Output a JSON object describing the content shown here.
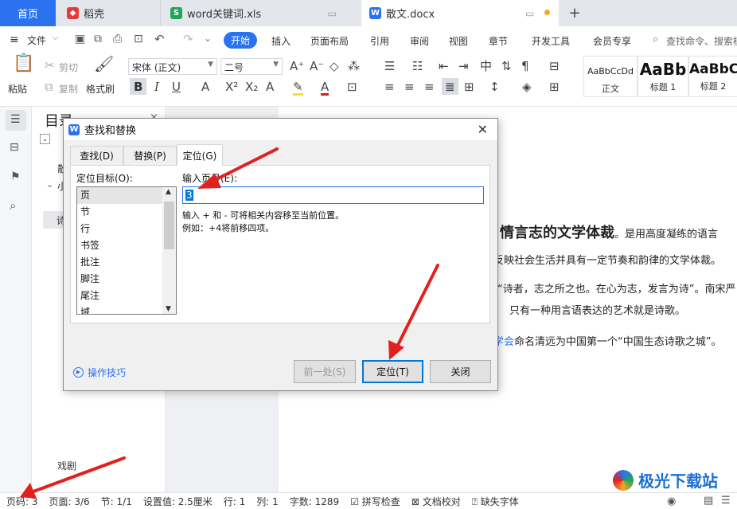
{
  "tabs": {
    "home": "首页",
    "daoke": "稻壳",
    "xls": "word关键词.xls",
    "docx": "散文.docx",
    "add": "+"
  },
  "menu": {
    "file": "文件",
    "items": [
      "开始",
      "插入",
      "页面布局",
      "引用",
      "审阅",
      "视图",
      "章节",
      "开发工具",
      "会员专享"
    ],
    "search": "查找命令、搜索模"
  },
  "ribbon": {
    "paste": "粘贴",
    "cut": "剪切",
    "copy": "复制",
    "format_painter": "格式刷",
    "font_name": "宋体 (正文)",
    "font_size": "二号",
    "styles": [
      {
        "sample": "AaBbCcDd",
        "name": "正文"
      },
      {
        "sample": "AaBb",
        "name": "标题 1"
      },
      {
        "sample": "AaBbC",
        "name": "标题 2"
      }
    ]
  },
  "nav": {
    "title": "目录",
    "item1": "散",
    "item2": "小",
    "item3": "诗",
    "bottom_item": "戏剧"
  },
  "document": {
    "line1_bold": "情言志的文学体裁",
    "line1_rest": "。是用高度凝练的语言",
    "line2": "反映社会生活并具有一定节奏和韵律的文学体裁。",
    "line3": "“诗者，志之所之也。在心为志，发言为诗”。南宋严",
    "line4": "只有一种用言语表达的艺术就是诗歌。",
    "line5_link": "学会",
    "line5_rest": "命名清远为中国第一个“中国生态诗歌之城”。"
  },
  "dialog": {
    "title": "查找和替换",
    "tab_find": "查找(D)",
    "tab_replace": "替换(P)",
    "tab_goto": "定位(G)",
    "target_label": "定位目标(O):",
    "targets": [
      "页",
      "节",
      "行",
      "书签",
      "批注",
      "脚注",
      "尾注",
      "域"
    ],
    "input_label": "输入页号(E):",
    "input_value": "3",
    "hint1": "输入 + 和 - 可将相关内容移至当前位置。",
    "hint2": "例如：+4将前移四项。",
    "tips": "操作技巧",
    "prev_button": "前一处(S)",
    "goto_button": "定位(T)",
    "close_button": "关闭"
  },
  "status": {
    "page_code": "页码: 3",
    "pages": "页面: 3/6",
    "section": "节: 1/1",
    "setting": "设置值: 2.5厘米",
    "row": "行: 1",
    "col": "列: 1",
    "words": "字数: 1289",
    "spell": "拼写检查",
    "proof": "文档校对",
    "missing_font": "缺失字体"
  },
  "watermark": "极光下载站",
  "colors": {
    "accent": "#2b72f0",
    "arrow": "#e0211d",
    "link": "#2b72f0"
  }
}
